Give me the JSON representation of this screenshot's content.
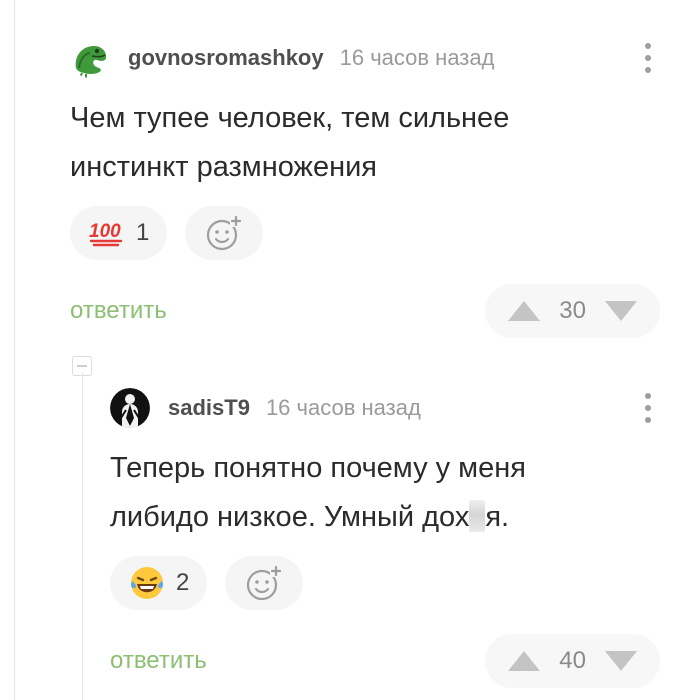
{
  "comments": [
    {
      "username": "govnosromashkoy",
      "time": "16 часов назад",
      "text_lines": [
        "Чем тупее человек, тем сильнее",
        "инстинкт размножения"
      ],
      "reaction": {
        "icon": "hundred-points-icon",
        "count": "1"
      },
      "reply_label": "ответить",
      "score": "30"
    },
    {
      "username": "sadisT9",
      "time": "16 часов назад",
      "text_line1": "Теперь понятно почему у меня",
      "text_line2_before": "либидо низкое. Умный дох",
      "text_line2_after": "я.",
      "reaction": {
        "icon": "laughing-tears-icon",
        "count": "2"
      },
      "reply_label": "ответить",
      "score": "40"
    }
  ],
  "colors": {
    "reply": "#8cbf72",
    "username": "#4f4f4f",
    "time": "#9a9a9a",
    "pill_bg": "#f5f5f5",
    "vote_arrow": "#c4c4c4"
  }
}
